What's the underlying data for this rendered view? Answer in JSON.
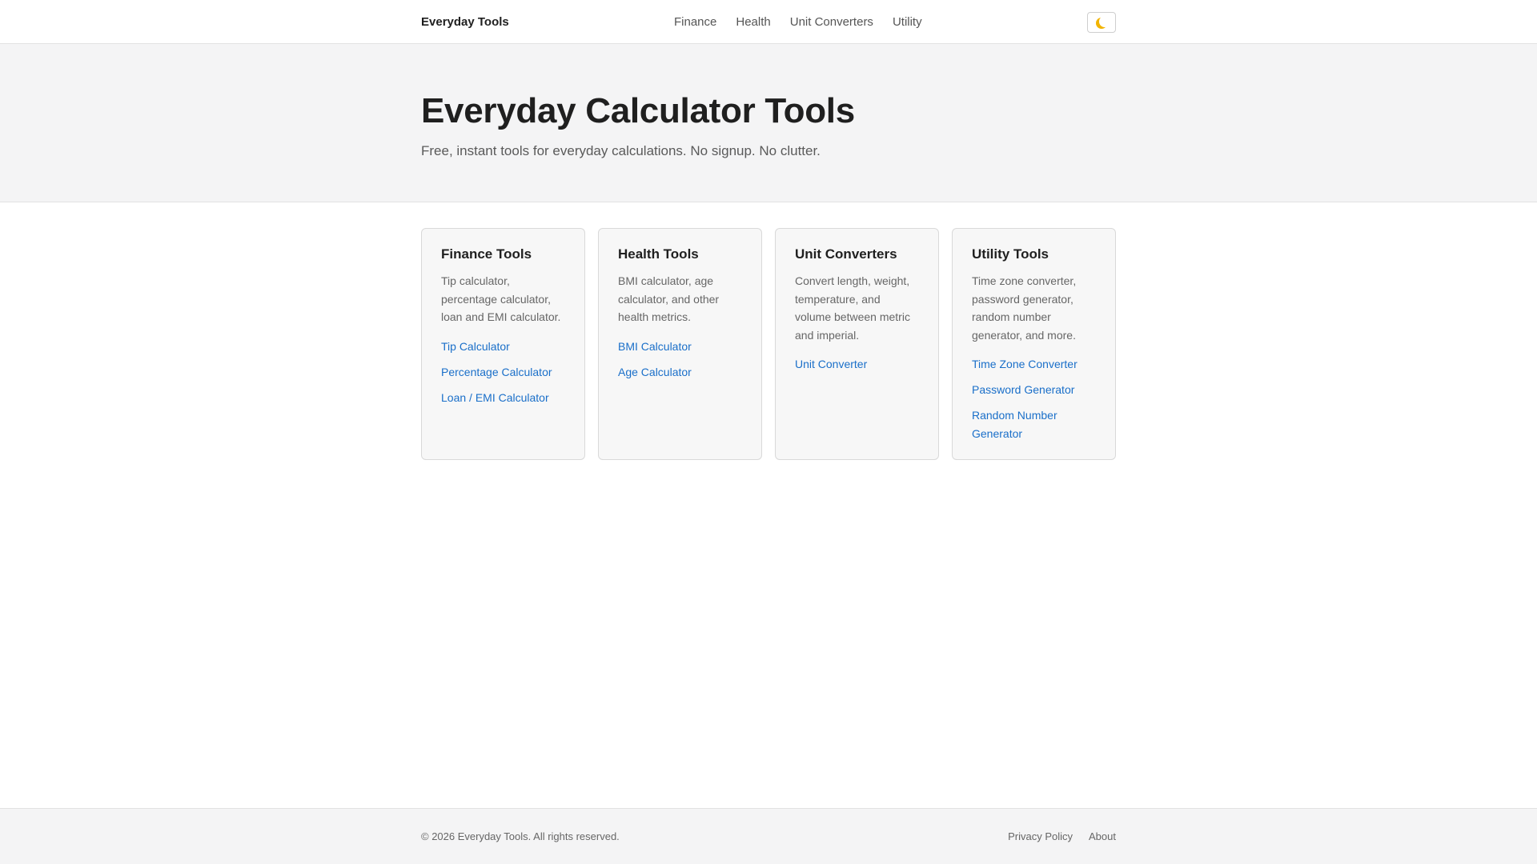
{
  "header": {
    "brand": "Everyday Tools",
    "nav": [
      "Finance",
      "Health",
      "Unit Converters",
      "Utility"
    ],
    "theme_toggle_icon": "moon-icon"
  },
  "hero": {
    "title": "Everyday Calculator Tools",
    "subtitle": "Free, instant tools for everyday calculations. No signup. No clutter."
  },
  "cards": [
    {
      "title": "Finance Tools",
      "description": "Tip calculator, percentage calculator, loan and EMI calculator.",
      "links": [
        "Tip Calculator",
        "Percentage Calculator",
        "Loan / EMI Calculator"
      ]
    },
    {
      "title": "Health Tools",
      "description": "BMI calculator, age calculator, and other health metrics.",
      "links": [
        "BMI Calculator",
        "Age Calculator"
      ]
    },
    {
      "title": "Unit Converters",
      "description": "Convert length, weight, temperature, and volume between metric and imperial.",
      "links": [
        "Unit Converter"
      ]
    },
    {
      "title": "Utility Tools",
      "description": "Time zone converter, password generator, random number generator, and more.",
      "links": [
        "Time Zone Converter",
        "Password Generator",
        "Random Number Generator"
      ]
    }
  ],
  "footer": {
    "copyright": "© 2026 Everyday Tools. All rights reserved.",
    "links": [
      "Privacy Policy",
      "About"
    ]
  },
  "colors": {
    "link": "#1a6fc9",
    "accent_moon": "#f2b400"
  }
}
